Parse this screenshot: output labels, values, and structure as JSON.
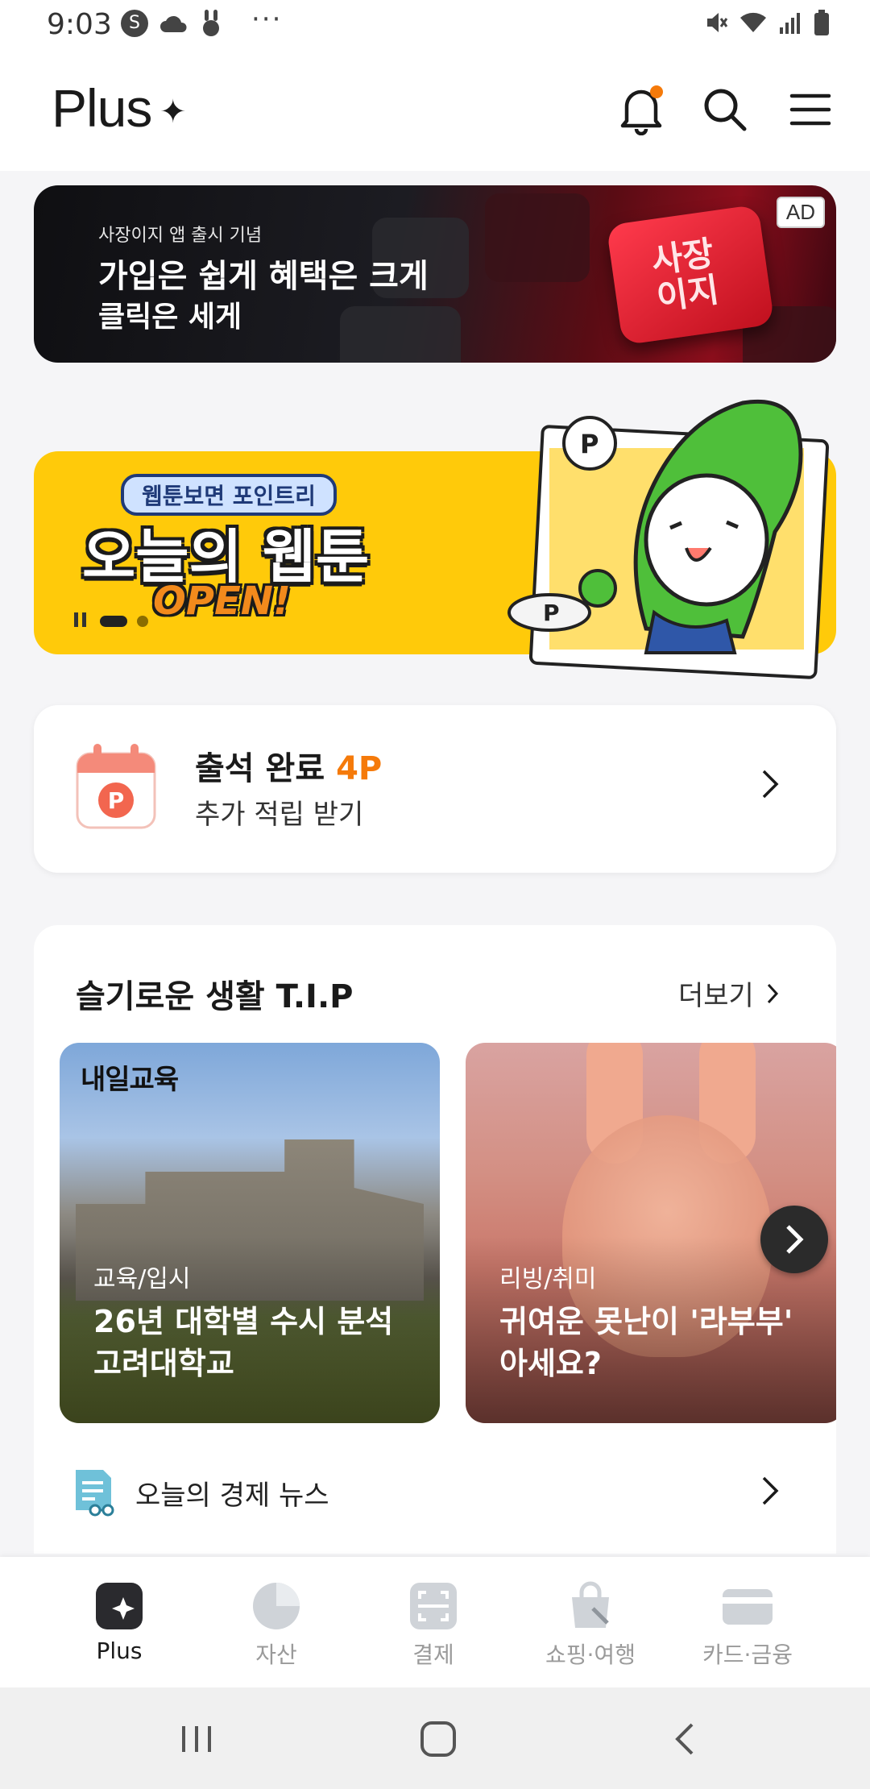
{
  "status_bar": {
    "time": "9:03",
    "more": "···"
  },
  "header": {
    "logo": "Plus",
    "logo_star": "✦"
  },
  "ad_banner": {
    "badge": "AD",
    "subtitle": "사장이지 앱 출시 기념",
    "line1": "가입은 쉽게 혜택은 크게",
    "line2": "클릭은 세게",
    "key_text_1": "사장",
    "key_text_2": "이지"
  },
  "webtoon_banner": {
    "pill": "웹툰보면 포인트리",
    "title": "오늘의 웹툰",
    "open": "OPEN!",
    "pager": {
      "current": 1,
      "total": 2
    }
  },
  "attendance": {
    "title": "출석 완료",
    "points": "4P",
    "subtitle": "추가 적립 받기",
    "calendar_letter": "P"
  },
  "tips": {
    "title": "슬기로운 생활 T.I.P",
    "more": "더보기",
    "items": [
      {
        "brand": "내일교육",
        "category": "교육/입시",
        "headline": "26년 대학별 수시 분석 고려대학교"
      },
      {
        "category": "리빙/취미",
        "headline": "귀여운 못난이 '라부부' 아세요?"
      }
    ],
    "news": "오늘의 경제 뉴스"
  },
  "bottom_nav": [
    {
      "label": "Plus",
      "active": true
    },
    {
      "label": "자산",
      "active": false
    },
    {
      "label": "결제",
      "active": false
    },
    {
      "label": "쇼핑·여행",
      "active": false
    },
    {
      "label": "카드·금융",
      "active": false
    }
  ],
  "colors": {
    "accent_orange": "#f57a0a",
    "notification_dot": "#f57a0a",
    "banner_yellow": "#ffca0a"
  }
}
